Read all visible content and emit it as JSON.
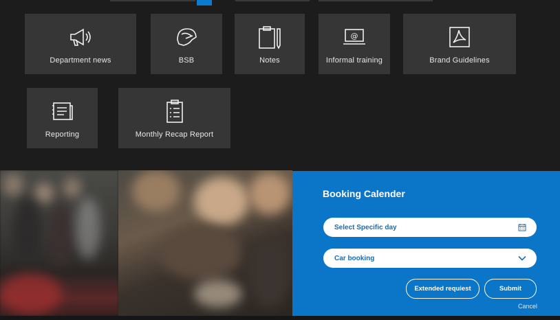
{
  "tiles": [
    {
      "name": "department-news",
      "label": "Department  news",
      "icon": "megaphone-icon"
    },
    {
      "name": "bsb",
      "label": "BSB",
      "icon": "helmet-icon"
    },
    {
      "name": "notes",
      "label": "Notes",
      "icon": "clipboard-pen-icon"
    },
    {
      "name": "informal-training",
      "label": "Informal  training",
      "icon": "laptop-at-icon"
    },
    {
      "name": "brand-guidelines",
      "label": "Brand Guidelines",
      "icon": "pdf-icon"
    },
    {
      "name": "reporting",
      "label": "Reporting",
      "icon": "report-binder-icon"
    },
    {
      "name": "monthly-recap-report",
      "label": "Monthly Recap Report",
      "icon": "checklist-icon"
    }
  ],
  "booking": {
    "title": "Booking Calender",
    "date_field": "Select Specific day",
    "booking_type": "Car booking",
    "extended_button": "Extended requiest",
    "submit_button": "Submit",
    "cancel_link": "Cancel"
  },
  "colors": {
    "background": "#1c1c1c",
    "tile": "#363636",
    "panel_blue": "#0b75c8",
    "field_text": "#1a6bb3"
  }
}
